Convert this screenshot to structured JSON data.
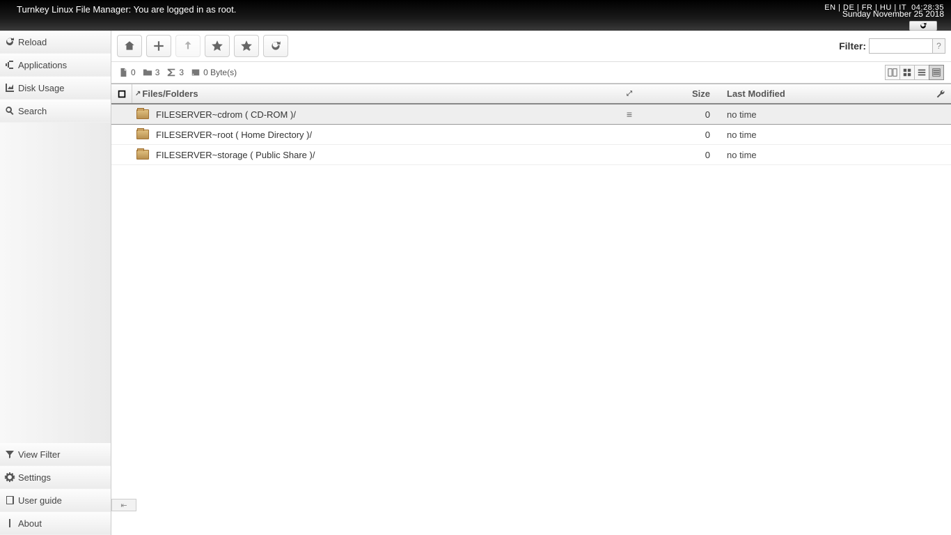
{
  "banner": {
    "title": "Turnkey Linux File Manager: You are logged in as root.",
    "langs": "EN | DE | FR | HU | IT",
    "time": "04:28:35",
    "date": "Sunday November 25 2018"
  },
  "sidebar": {
    "top": [
      {
        "id": "reload",
        "label": "Reload",
        "icon": "refresh"
      },
      {
        "id": "applications",
        "label": "Applications",
        "icon": "apps"
      },
      {
        "id": "diskusage",
        "label": "Disk Usage",
        "icon": "chart"
      },
      {
        "id": "search",
        "label": "Search",
        "icon": "search"
      }
    ],
    "bottom": [
      {
        "id": "viewfilter",
        "label": "View Filter",
        "icon": "filter"
      },
      {
        "id": "settings",
        "label": "Settings",
        "icon": "gear"
      },
      {
        "id": "userguide",
        "label": "User guide",
        "icon": "book"
      },
      {
        "id": "about",
        "label": "About",
        "icon": "info"
      }
    ]
  },
  "toolbar": {
    "home_icon": "home",
    "add_icon": "plus",
    "up_icon": "upload",
    "bookmark_icon": "star",
    "bookmark_add_icon": "star-add",
    "refresh_icon": "refresh",
    "filter_label": "Filter:",
    "filter_value": "",
    "filter_help": "?"
  },
  "status": {
    "files": "0",
    "folders": "3",
    "total": "3",
    "bytes": "0 Byte(s)"
  },
  "columns": {
    "name": "Files/Folders",
    "size": "Size",
    "modified": "Last Modified"
  },
  "rows": [
    {
      "name": "FILESERVER~cdrom ( CD-ROM )/",
      "size": "0",
      "modified": "no time",
      "selected": true
    },
    {
      "name": "FILESERVER~root ( Home Directory )/",
      "size": "0",
      "modified": "no time",
      "selected": false
    },
    {
      "name": "FILESERVER~storage ( Public Share )/",
      "size": "0",
      "modified": "no time",
      "selected": false
    }
  ]
}
